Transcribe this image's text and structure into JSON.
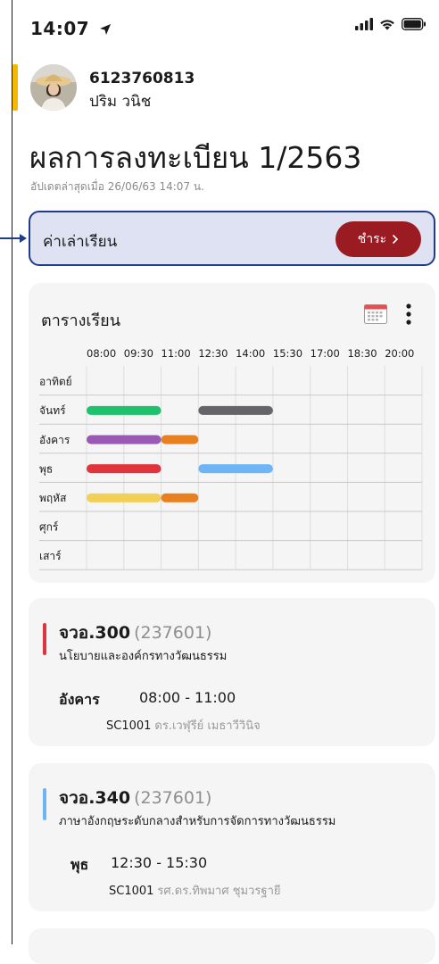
{
  "status": {
    "time": "14:07"
  },
  "user": {
    "id": "6123760813",
    "name": "ปริม วนิช"
  },
  "page": {
    "title": "ผลการลงทะเบียน 1/2563",
    "updated": "อัปเดตล่าสุดเมื่อ 26/06/63 14:07 น."
  },
  "tuition": {
    "label": "ค่าเล่าเรียน",
    "pay_label": "ชำระ",
    "pay_color": "#9b1b22"
  },
  "schedule": {
    "title": "ตารางเรียน",
    "time_labels": [
      "08:00",
      "09:30",
      "11:00",
      "12:30",
      "14:00",
      "15:30",
      "17:00",
      "18:30",
      "20:00"
    ],
    "days": [
      "อาทิตย์",
      "จันทร์",
      "อังคาร",
      "พุธ",
      "พฤหัส",
      "ศุกร์",
      "เสาร์"
    ],
    "blocks": [
      {
        "day": 1,
        "start": "08:00",
        "end": "11:00",
        "color": "#1ec26a"
      },
      {
        "day": 1,
        "start": "12:30",
        "end": "15:30",
        "color": "#646469"
      },
      {
        "day": 2,
        "start": "08:00",
        "end": "11:00",
        "color": "#9b59b6"
      },
      {
        "day": 2,
        "start": "11:00",
        "end": "12:30",
        "color": "#e8801f"
      },
      {
        "day": 3,
        "start": "08:00",
        "end": "11:00",
        "color": "#e0353d"
      },
      {
        "day": 3,
        "start": "12:30",
        "end": "15:30",
        "color": "#6db5f5"
      },
      {
        "day": 4,
        "start": "08:00",
        "end": "11:00",
        "color": "#f2cf55"
      },
      {
        "day": 4,
        "start": "11:00",
        "end": "12:30",
        "color": "#e8801f"
      }
    ]
  },
  "courses": [
    {
      "code": "จวอ.300",
      "section": "(237601)",
      "name": "นโยบายและองค์กรทางวัฒนธรรม",
      "day": "อังคาร",
      "time": "08:00 - 11:00",
      "room": "SC1001",
      "teacher": "ดร.เวฬุรีย์ เมธาวีวินิจ",
      "color": "#e0353d"
    },
    {
      "code": "จวอ.340",
      "section": "(237601)",
      "name": "ภาษาอังกฤษระดับกลางสำหรับการจัดการทางวัฒนธรรม",
      "day": "พุธ",
      "time": "12:30 - 15:30",
      "room": "SC1001",
      "teacher": "รศ.ดร.ทิพมาศ ชุมวรฐายี",
      "color": "#6db5f5"
    }
  ]
}
